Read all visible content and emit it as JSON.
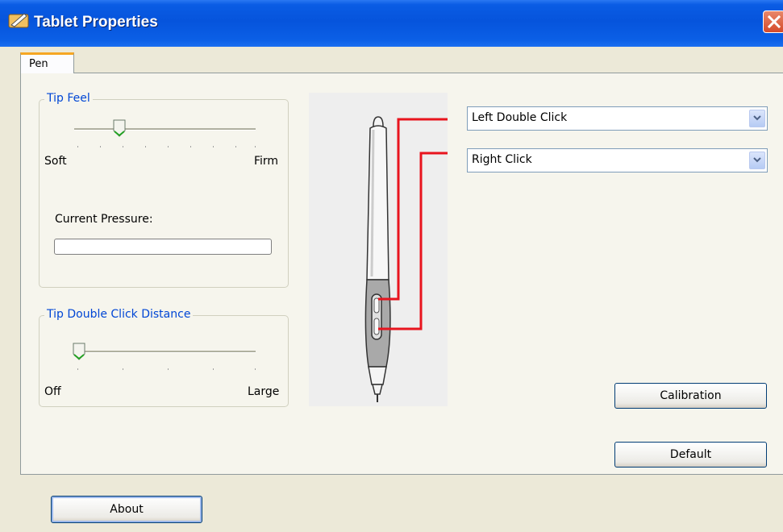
{
  "window": {
    "title": "Tablet Properties"
  },
  "tabs": [
    {
      "label": "Pen"
    }
  ],
  "tip_feel": {
    "label": "Tip Feel",
    "min_label": "Soft",
    "max_label": "Firm",
    "level": 0.25,
    "current_pressure_label": "Current Pressure:",
    "current_pressure": 0
  },
  "tip_double_click": {
    "label": "Tip Double Click Distance",
    "min_label": "Off",
    "max_label": "Large",
    "level": 0.0
  },
  "pen_buttons": {
    "upper": {
      "value": "Left Double Click"
    },
    "lower": {
      "value": "Right Click"
    }
  },
  "buttons": {
    "calibration": "Calibration",
    "default": "Default",
    "about": "About"
  },
  "icons": {
    "app": "tablet-app-icon",
    "close": "close-icon",
    "dropdown": "chevron-down-icon",
    "slider_thumb": "slider-thumb-icon",
    "pen": "pen-illustration"
  },
  "colors": {
    "titlebar": "#0654dc",
    "group_label": "#0046d5",
    "callout_line": "#e8141e",
    "close_button": "#d54a2b"
  }
}
